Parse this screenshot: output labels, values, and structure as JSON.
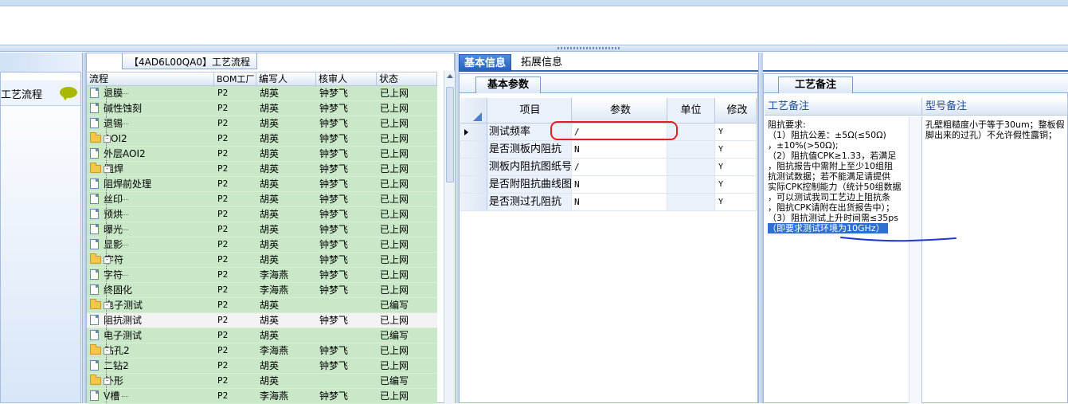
{
  "tree_panel": {
    "title": "【4AD6L00QA0】工艺流程",
    "columns": [
      "流程",
      "BOM工厂",
      "编写人",
      "核审人",
      "状态"
    ],
    "rows": [
      {
        "name": "退膜",
        "level": 2,
        "bom": "P2",
        "writer": "胡英",
        "reviewer": "钟梦飞",
        "status": "已上网"
      },
      {
        "name": "碱性蚀刻",
        "level": 2,
        "bom": "P2",
        "writer": "胡英",
        "reviewer": "钟梦飞",
        "status": "已上网"
      },
      {
        "name": "退锡",
        "level": 2,
        "bom": "P2",
        "writer": "胡英",
        "reviewer": "钟梦飞",
        "status": "已上网"
      },
      {
        "name": "AOI2",
        "level": 1,
        "bom": "P2",
        "writer": "胡英",
        "reviewer": "钟梦飞",
        "status": "已上网"
      },
      {
        "name": "外层AOI2",
        "level": 2,
        "bom": "P2",
        "writer": "胡英",
        "reviewer": "钟梦飞",
        "status": "已上网"
      },
      {
        "name": "阻焊",
        "level": 1,
        "bom": "P2",
        "writer": "胡英",
        "reviewer": "钟梦飞",
        "status": "已上网"
      },
      {
        "name": "阻焊前处理",
        "level": 2,
        "bom": "P2",
        "writer": "胡英",
        "reviewer": "钟梦飞",
        "status": "已上网"
      },
      {
        "name": "丝印",
        "level": 2,
        "bom": "P2",
        "writer": "胡英",
        "reviewer": "钟梦飞",
        "status": "已上网"
      },
      {
        "name": "预烘",
        "level": 2,
        "bom": "P2",
        "writer": "胡英",
        "reviewer": "钟梦飞",
        "status": "已上网"
      },
      {
        "name": "曝光",
        "level": 2,
        "bom": "P2",
        "writer": "胡英",
        "reviewer": "钟梦飞",
        "status": "已上网"
      },
      {
        "name": "显影",
        "level": 2,
        "bom": "P2",
        "writer": "胡英",
        "reviewer": "钟梦飞",
        "status": "已上网"
      },
      {
        "name": "字符",
        "level": 1,
        "bom": "P2",
        "writer": "胡英",
        "reviewer": "钟梦飞",
        "status": "已上网"
      },
      {
        "name": "字符",
        "level": 2,
        "bom": "P2",
        "writer": "李海燕",
        "reviewer": "钟梦飞",
        "status": "已上网"
      },
      {
        "name": "终固化",
        "level": 2,
        "bom": "P2",
        "writer": "李海燕",
        "reviewer": "钟梦飞",
        "status": "已上网"
      },
      {
        "name": "电子测试",
        "level": 1,
        "bom": "P2",
        "writer": "胡英",
        "reviewer": "",
        "status": "已编写"
      },
      {
        "name": "阻抗测试",
        "level": 2,
        "bom": "P2",
        "writer": "胡英",
        "reviewer": "钟梦飞",
        "status": "已上网",
        "selected": true
      },
      {
        "name": "电子测试",
        "level": 2,
        "bom": "P2",
        "writer": "胡英",
        "reviewer": "",
        "status": "已编写"
      },
      {
        "name": "钻孔2",
        "level": 1,
        "bom": "P2",
        "writer": "李海燕",
        "reviewer": "钟梦飞",
        "status": "已上网"
      },
      {
        "name": "二钻2",
        "level": 2,
        "bom": "P2",
        "writer": "胡英",
        "reviewer": "钟梦飞",
        "status": "已上网"
      },
      {
        "name": "外形",
        "level": 1,
        "bom": "P2",
        "writer": "胡英",
        "reviewer": "",
        "status": "已编写"
      },
      {
        "name": "V槽",
        "level": 2,
        "bom": "P2",
        "writer": "李海燕",
        "reviewer": "钟梦飞",
        "status": "已上网"
      }
    ]
  },
  "left_nav": {
    "item_label": "工艺流程"
  },
  "right_tabs": {
    "basic": "基本信息",
    "extended": "拓展信息"
  },
  "params": {
    "tab_label": "基本参数",
    "columns": [
      "项目",
      "参数",
      "单位",
      "修改"
    ],
    "rows": [
      {
        "item": "测试频率",
        "value": "/",
        "unit": "",
        "mod": "Y",
        "current": true
      },
      {
        "item": "是否测板内阻抗",
        "value": "N",
        "unit": "",
        "mod": "Y"
      },
      {
        "item": "测板内阻抗图纸号",
        "value": "/",
        "unit": "",
        "mod": "Y"
      },
      {
        "item": "是否附阻抗曲线图",
        "value": "N",
        "unit": "",
        "mod": "Y"
      },
      {
        "item": "是否测过孔阻抗",
        "value": "N",
        "unit": "",
        "mod": "Y"
      }
    ]
  },
  "notes": {
    "tab_label": "工艺备注",
    "col_process": "工艺备注",
    "col_model": "型号备注",
    "process_lines": [
      "阻抗要求:",
      "（1）阻抗公差：±5Ω(≤50Ω)",
      "，±10%(>50Ω);",
      "（2）阻抗值CPK≥1.33，若满足",
      "，阻抗报告中需附上至少10组阻",
      "抗测试数据；若不能满足请提供",
      "实际CPK控制能力（统计50组数据",
      "，可以测试我司工艺边上阻抗条",
      "，阻抗CPK请附在出货报告中）；",
      "（3）阻抗测试上升时间需≤35ps"
    ],
    "process_highlight": "（即要求测试环境为10GHz）",
    "model_lines": [
      "孔壁粗糙度小于等于30um；整板假",
      "脚出来的过孔）不允许假性露铜；"
    ]
  },
  "colors": {
    "tree_row_bg": "#c9e8c8",
    "accent_blue": "#2660ba",
    "annotation_red": "#e0201c",
    "annotation_blue": "#1f35d6"
  }
}
